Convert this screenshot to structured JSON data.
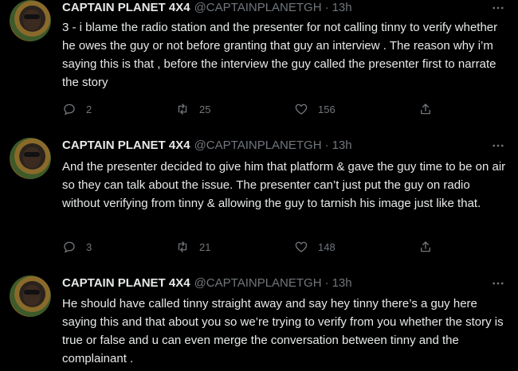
{
  "tweets": [
    {
      "name": "CAPTAIN PLANET 4X4",
      "handle": "@CAPTAINPLANETGH",
      "separator": "·",
      "time": "13h",
      "text": "3 - i blame the radio station and the presenter for not calling tinny to verify whether he owes the guy or not before granting that guy an interview . The reason why i’m saying this is that , before the interview the guy called the presenter first to narrate the story",
      "replies": "2",
      "retweets": "25",
      "likes": "156"
    },
    {
      "name": "CAPTAIN PLANET 4X4",
      "handle": "@CAPTAINPLANETGH",
      "separator": "·",
      "time": "13h",
      "text": "And the presenter decided to give him that platform & gave the guy time to be on air so they can talk about the issue.  The presenter can’t just put the guy on radio without verifying from tinny & allowing the guy to tarnish his image just like that.",
      "replies": "3",
      "retweets": "21",
      "likes": "148"
    },
    {
      "name": "CAPTAIN PLANET 4X4",
      "handle": "@CAPTAINPLANETGH",
      "separator": "·",
      "time": "13h",
      "text": "He should have called tinny straight away and say hey tinny there’s a guy here saying this and that about you so we’re trying to verify from you whether the story is true or false and u can even merge the conversation between tinny and the complainant ."
    }
  ],
  "icons": {
    "reply": "reply-icon",
    "retweet": "retweet-icon",
    "like": "heart-icon",
    "share": "share-icon",
    "more": "more-icon"
  },
  "colors": {
    "background": "#000000",
    "text": "#e7e9ea",
    "muted": "#71767b"
  }
}
